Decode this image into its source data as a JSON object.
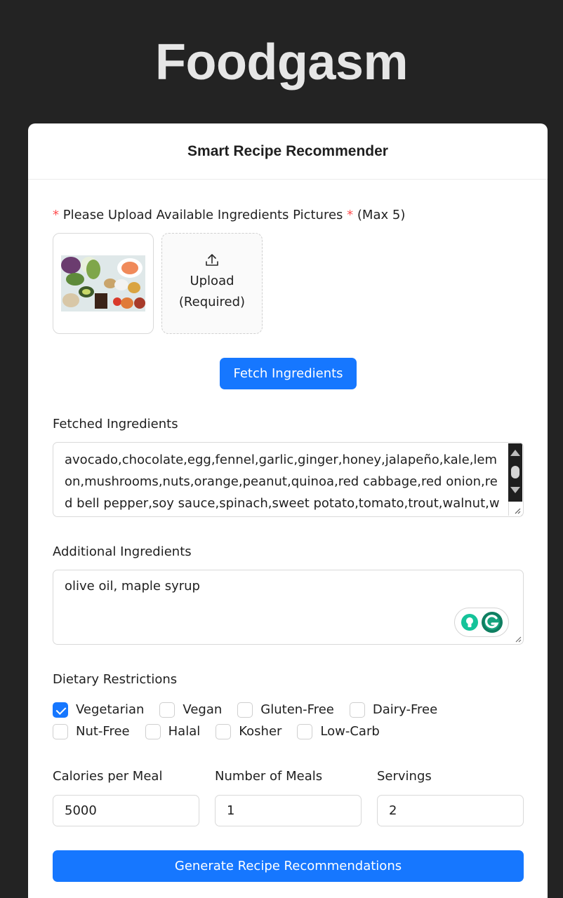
{
  "app": {
    "title": "Foodgasm"
  },
  "card": {
    "title": "Smart Recipe Recommender"
  },
  "upload": {
    "required_mark": "*",
    "label": "Please Upload Available Ingredients Pictures",
    "suffix": "(Max 5)",
    "button_line1": "Upload",
    "button_line2": "(Required)"
  },
  "fetch_button": "Fetch Ingredients",
  "fetched": {
    "label": "Fetched Ingredients",
    "value": "avocado,chocolate,egg,fennel,garlic,ginger,honey,jalapeño,kale,lemon,mushrooms,nuts,orange,peanut,quinoa,red cabbage,red onion,red bell pepper,soy sauce,spinach,sweet potato,tomato,trout,walnut,wheat"
  },
  "additional": {
    "label": "Additional Ingredients",
    "value": "olive oil, maple syrup"
  },
  "dietary": {
    "label": "Dietary Restrictions",
    "options": [
      {
        "label": "Vegetarian",
        "checked": true
      },
      {
        "label": "Vegan",
        "checked": false
      },
      {
        "label": "Gluten-Free",
        "checked": false
      },
      {
        "label": "Dairy-Free",
        "checked": false
      },
      {
        "label": "Nut-Free",
        "checked": false
      },
      {
        "label": "Halal",
        "checked": false
      },
      {
        "label": "Kosher",
        "checked": false
      },
      {
        "label": "Low-Carb",
        "checked": false
      }
    ]
  },
  "fields": {
    "calories": {
      "label": "Calories per Meal",
      "value": "5000"
    },
    "meals": {
      "label": "Number of Meals",
      "value": "1"
    },
    "servings": {
      "label": "Servings",
      "value": "2"
    }
  },
  "generate_button": "Generate Recipe Recommendations",
  "colors": {
    "primary": "#1677ff",
    "background": "#232323",
    "required": "#ff4d4f",
    "grammarly": "#15c39a"
  }
}
